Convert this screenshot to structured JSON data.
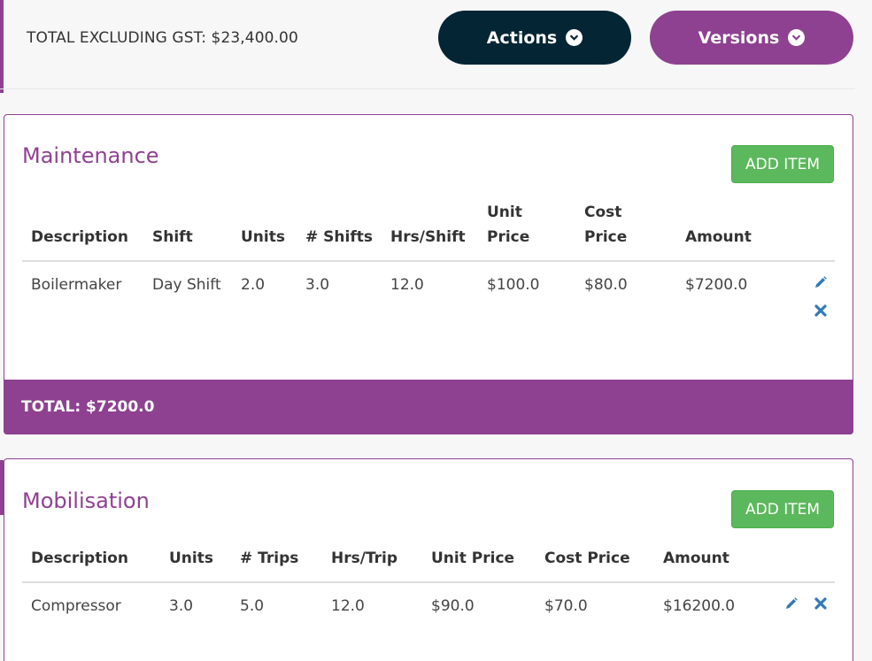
{
  "header": {
    "total_label": "TOTAL EXCLUDING GST: $23,400.00",
    "actions_label": "Actions",
    "versions_label": "Versions"
  },
  "colors": {
    "brand": "#8e4191",
    "dark": "#032534",
    "success": "#5cb85c",
    "icon": "#337ab7"
  },
  "maintenance": {
    "title": "Maintenance",
    "add_label": "ADD ITEM",
    "headers": [
      "Description",
      "Shift",
      "Units",
      "# Shifts",
      "Hrs/Shift",
      "Unit Price",
      "Cost Price",
      "Amount"
    ],
    "rows": [
      [
        "Boilermaker",
        "Day Shift",
        "2.0",
        "3.0",
        "12.0",
        "$100.0",
        "$80.0",
        "$7200.0"
      ]
    ],
    "total_label": "TOTAL: $7200.0"
  },
  "mobilisation": {
    "title": "Mobilisation",
    "add_label": "ADD ITEM",
    "headers": [
      "Description",
      "Units",
      "# Trips",
      "Hrs/Trip",
      "Unit Price",
      "Cost Price",
      "Amount"
    ],
    "rows": [
      [
        "Compressor",
        "3.0",
        "5.0",
        "12.0",
        "$90.0",
        "$70.0",
        "$16200.0"
      ]
    ]
  },
  "icons": {
    "edit": "pencil-icon",
    "delete": "close-icon",
    "dropdown": "chevron-down-icon"
  }
}
